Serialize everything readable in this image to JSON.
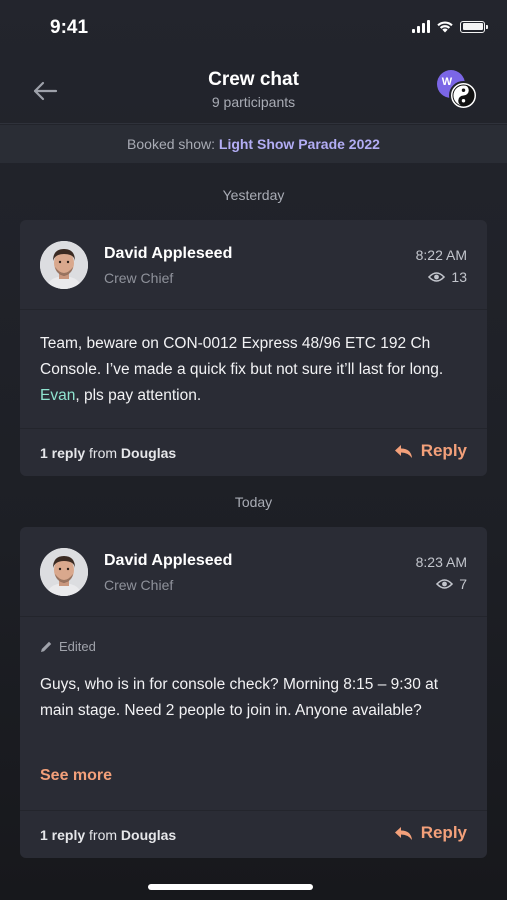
{
  "status_bar": {
    "time": "9:41"
  },
  "header": {
    "title": "Crew chat",
    "subtitle": "9 participants",
    "avatar_initial": "W"
  },
  "booked": {
    "label": "Booked show:",
    "show_name": "Light Show Parade 2022"
  },
  "days": {
    "yesterday": "Yesterday",
    "today": "Today"
  },
  "messages": [
    {
      "author": "David Appleseed",
      "role": "Crew Chief",
      "time": "8:22 AM",
      "views": "13",
      "text_before": "Team, beware on CON-0012 Express 48/96 ETC 192 Ch Console. I’ve made a quick fix but not sure it’ll last for long. ",
      "mention": "Evan",
      "text_after": ", pls pay attention.",
      "reply_count": "1 reply",
      "reply_from_label": "from",
      "reply_from": "Douglas",
      "reply_label": "Reply"
    },
    {
      "author": "David Appleseed",
      "role": "Crew Chief",
      "time": "8:23 AM",
      "views": "7",
      "edited_label": "Edited",
      "text": "Guys, who is in for console check? Morning 8:15  – 9:30 at main stage. Need 2 people to join in. Anyone available?",
      "see_more": "See more",
      "reply_count": "1 reply",
      "reply_from_label": "from",
      "reply_from": "Douglas",
      "reply_label": "Reply"
    }
  ],
  "colors": {
    "background": "#202229",
    "card": "#2a2c35",
    "accent_orange": "#f3a07a",
    "accent_purple": "#b3adf5",
    "mention": "#8fe3cf",
    "avatar_purple": "#7b66e6"
  },
  "icons": {
    "back": "arrow-left-icon",
    "views": "eye-icon",
    "reply": "reply-arrow-icon",
    "edited": "pencil-icon"
  }
}
